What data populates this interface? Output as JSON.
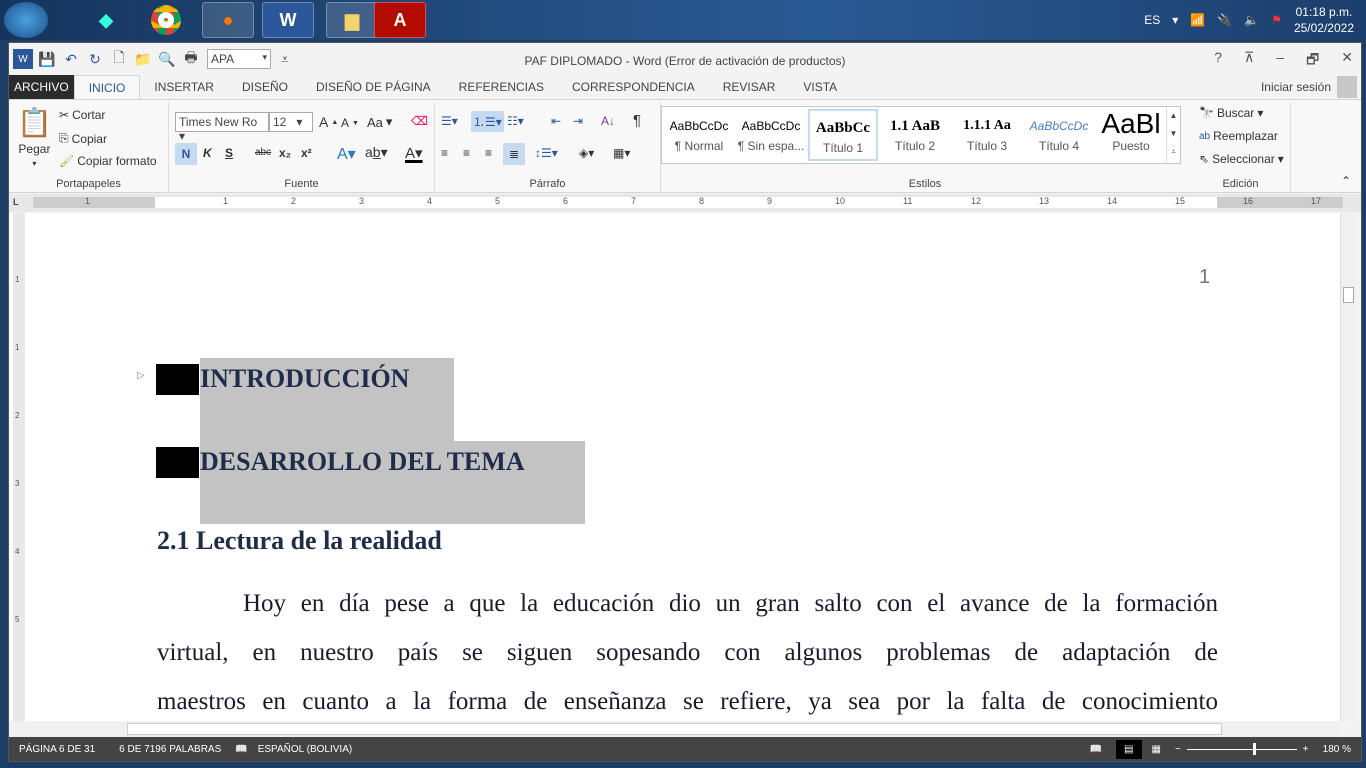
{
  "taskbar": {
    "apps": [
      "start",
      "filmora",
      "chrome",
      "firefox",
      "word",
      "explorer",
      "acrobat"
    ],
    "language": "ES",
    "time": "01:18 p.m.",
    "date": "25/02/2022"
  },
  "titlebar": {
    "title": "PAF DIPLOMADO - Word (Error de activación de productos)",
    "style_value": "APA",
    "help": "?",
    "min": "–",
    "restore": "🗗",
    "close": "✕"
  },
  "tabs": [
    "ARCHIVO",
    "INICIO",
    "INSERTAR",
    "DISEÑO",
    "DISEÑO DE PÁGINA",
    "REFERENCIAS",
    "CORRESPONDENCIA",
    "REVISAR",
    "VISTA"
  ],
  "login": "Iniciar sesión",
  "ribbon": {
    "clipboard": {
      "label": "Portapapeles",
      "paste": "Pegar",
      "cut": "Cortar",
      "copy": "Copiar",
      "format_painter": "Copiar formato"
    },
    "font": {
      "label": "Fuente",
      "name": "Times New Ro",
      "size": "12",
      "bold": "N",
      "italic": "K",
      "underline": "S",
      "strike": "abc",
      "sub": "x₂",
      "sup": "x²",
      "case": "Aa"
    },
    "paragraph": {
      "label": "Párrafo"
    },
    "styles": {
      "label": "Estilos",
      "items": [
        {
          "preview": "AaBbCcDc",
          "name": "¶ Normal"
        },
        {
          "preview": "AaBbCcDc",
          "name": "¶ Sin espa..."
        },
        {
          "preview": "AaBbCc",
          "name": "Título 1"
        },
        {
          "preview": "1.1  AaB",
          "name": "Título 2"
        },
        {
          "preview": "1.1.1  Aa",
          "name": "Título 3"
        },
        {
          "preview": "AaBbCcDc",
          "name": "Título 4"
        },
        {
          "preview": "AaBl",
          "name": "Puesto"
        }
      ]
    },
    "editing": {
      "label": "Edición",
      "find": "Buscar",
      "replace": "Reemplazar",
      "select": "Seleccionar"
    }
  },
  "ruler": {
    "ticks": [
      "1",
      "1",
      "2",
      "3",
      "4",
      "5",
      "6",
      "7",
      "8",
      "9",
      "10",
      "11",
      "12",
      "13",
      "14",
      "15",
      "16",
      "17"
    ],
    "vticks": [
      "1",
      "1",
      "2",
      "3",
      "4",
      "5"
    ]
  },
  "document": {
    "page_number": "1",
    "heading1": "INTRODUCCIÓN",
    "heading2": "DESARROLLO DEL TEMA",
    "heading3": "2.1 Lectura de la realidad",
    "lines": [
      "Hoy en día pese a que la educación dio un gran salto con el avance de la formación",
      "virtual, en nuestro país se siguen sopesando con algunos problemas de adaptación de",
      "maestros en cuanto a la forma de enseñanza se refiere, ya sea por la falta de conocimiento"
    ]
  },
  "status": {
    "page": "PÁGINA 6 DE 31",
    "words": "6 DE 7196 PALABRAS",
    "language": "ESPAÑOL (BOLIVIA)",
    "zoom": "180 %",
    "zoom_percent": 180
  }
}
